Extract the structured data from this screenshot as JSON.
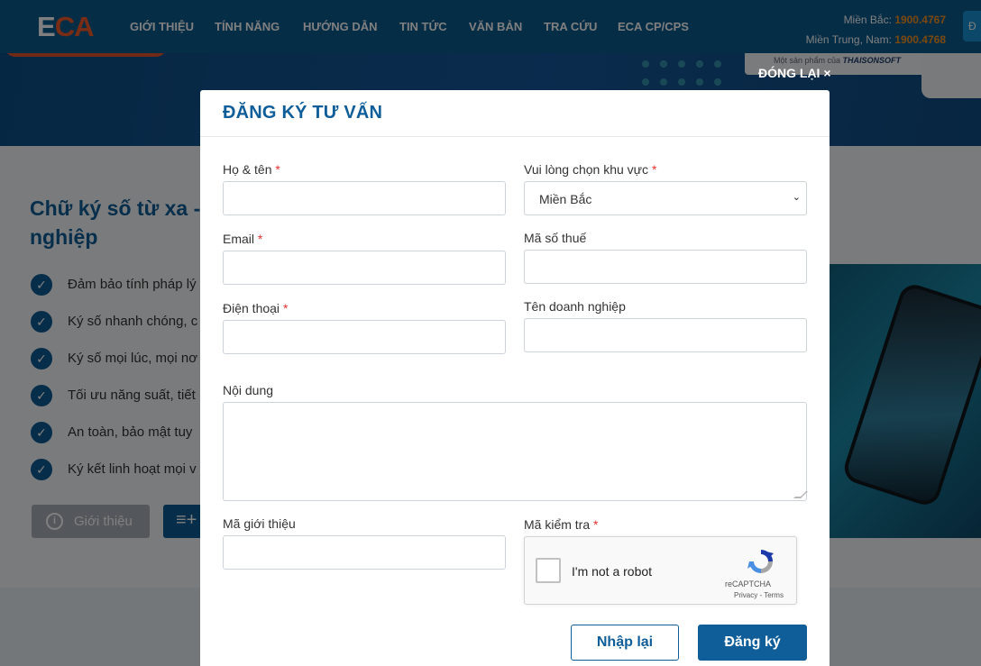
{
  "header": {
    "logo_e": "E",
    "logo_ca": "CA",
    "nav": [
      "GIỚI THIỆU",
      "TÍNH NĂNG",
      "HƯỚNG DẪN",
      "TIN TỨC",
      "VĂN BẢN",
      "TRA CỨU",
      "ECA CP/CPS"
    ],
    "hotline_north_label": "Miền Bắc: ",
    "hotline_north": "1900.4767",
    "hotline_south_label": "Miền Trung, Nam: ",
    "hotline_south": "1900.4768",
    "cta_partial": "Đ"
  },
  "banner": {
    "product_of": "Một sản phẩm của",
    "brand": "THAISONSOFT",
    "close_label": "ĐÓNG LẠI ×"
  },
  "background_content": {
    "title": "Chữ ký số từ xa - nghiệp",
    "features": [
      "Đảm bảo tính pháp lý",
      "Ký số nhanh chóng, c",
      "Ký số mọi lúc, mọi nơ",
      "Tối ưu năng suất, tiết",
      "An toàn, bảo mật tuy",
      "Ký kết linh hoạt mọi v"
    ],
    "intro_button": "Giới thiệu",
    "list_button_icon": "≡+"
  },
  "modal": {
    "title": "ĐĂNG KÝ TƯ VẤN",
    "fields": {
      "name_label": "Họ & tên",
      "region_label": "Vui lòng chọn khu vực",
      "region_value": "Miền Bắc",
      "email_label": "Email",
      "tax_label": "Mã số thuế",
      "phone_label": "Điện thoại",
      "company_label": "Tên doanh nghiệp",
      "content_label": "Nội dung",
      "referral_label": "Mã giới thiệu",
      "captcha_label": "Mã kiểm tra"
    },
    "required_mark": "*",
    "captcha": {
      "text": "I'm not a robot",
      "brand": "reCAPTCHA",
      "terms": "Privacy - Terms"
    },
    "buttons": {
      "reset": "Nhập lại",
      "submit": "Đăng ký"
    }
  },
  "colors": {
    "primary": "#0f5e99",
    "accent": "#f05a28",
    "required": "#e0322f",
    "overlay": "rgba(0,0,0,0.5)"
  }
}
